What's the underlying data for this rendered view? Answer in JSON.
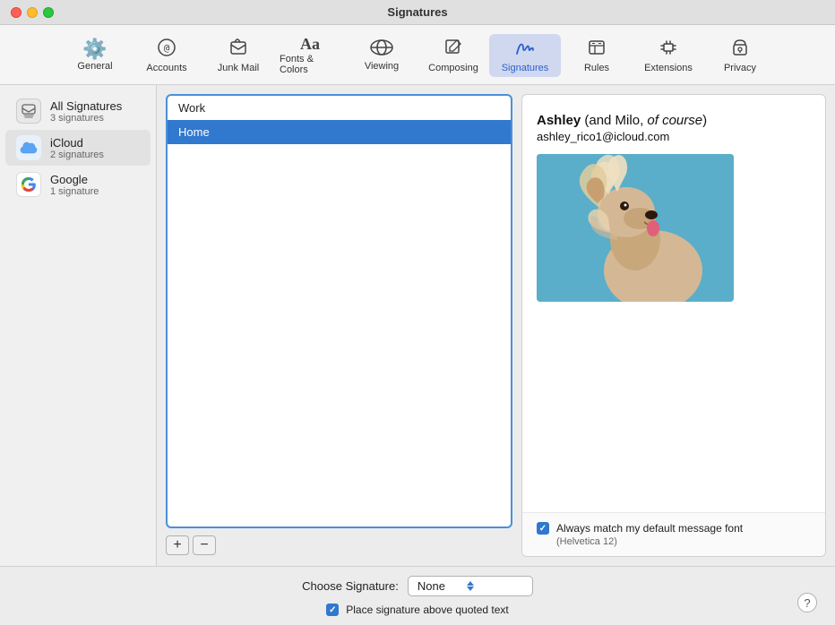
{
  "window": {
    "title": "Signatures"
  },
  "toolbar": {
    "items": [
      {
        "id": "general",
        "label": "General",
        "icon": "⚙️"
      },
      {
        "id": "accounts",
        "label": "Accounts",
        "icon": "✉️"
      },
      {
        "id": "junk-mail",
        "label": "Junk Mail",
        "icon": "🗑️"
      },
      {
        "id": "fonts-colors",
        "label": "Fonts & Colors",
        "icon": "Aa"
      },
      {
        "id": "viewing",
        "label": "Viewing",
        "icon": "👓"
      },
      {
        "id": "composing",
        "label": "Composing",
        "icon": "✏️"
      },
      {
        "id": "signatures",
        "label": "Signatures",
        "icon": "✍️",
        "active": true
      },
      {
        "id": "rules",
        "label": "Rules",
        "icon": "📋"
      },
      {
        "id": "extensions",
        "label": "Extensions",
        "icon": "🔩"
      },
      {
        "id": "privacy",
        "label": "Privacy",
        "icon": "✋"
      }
    ]
  },
  "sidebar": {
    "items": [
      {
        "id": "all-signatures",
        "name": "All Signatures",
        "count": "3 signatures",
        "type": "all"
      },
      {
        "id": "icloud",
        "name": "iCloud",
        "count": "2 signatures",
        "type": "icloud"
      },
      {
        "id": "google",
        "name": "Google",
        "count": "1 signature",
        "type": "google"
      }
    ]
  },
  "signatures_list": {
    "items": [
      {
        "id": "work",
        "label": "Work",
        "selected": false
      },
      {
        "id": "home",
        "label": "Home",
        "selected": true
      }
    ],
    "add_button": "+",
    "remove_button": "−"
  },
  "signature_preview": {
    "name_bold": "Ashley",
    "name_suffix": " (and Milo, ",
    "name_italic": "of course",
    "name_end": ")",
    "email": "ashley_rico1@icloud.com",
    "font_match_label": "Always match my default message font",
    "font_hint": "(Helvetica 12)"
  },
  "bottom_bar": {
    "choose_label": "Choose Signature:",
    "choose_value": "None",
    "place_label": "Place signature above quoted text",
    "help": "?"
  }
}
